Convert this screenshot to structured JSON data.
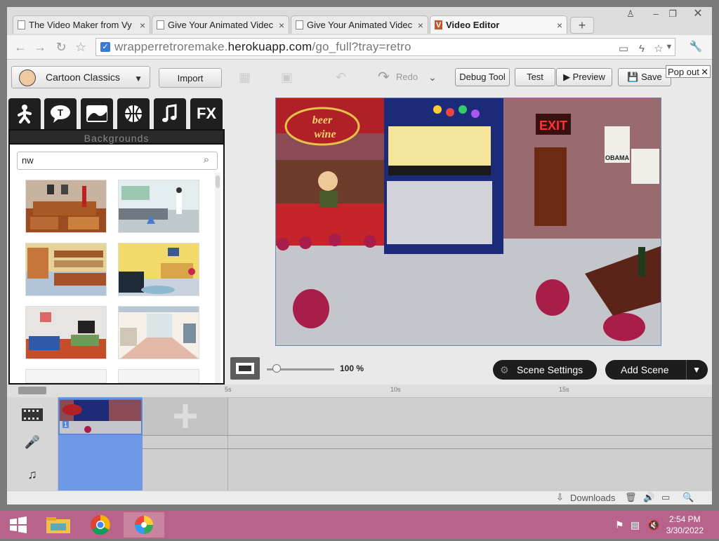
{
  "browser": {
    "tabs": [
      {
        "title": "The Video Maker from Vy",
        "active": false
      },
      {
        "title": "Give Your Animated Videc",
        "active": false
      },
      {
        "title": "Give Your Animated Videc",
        "active": false
      },
      {
        "title": "Video Editor",
        "active": true
      }
    ],
    "new_tab_symbol": "+",
    "url_prefix": "wrapperretroremake.",
    "url_domain": "herokuapp.com",
    "url_path": "/go_full?tray=retro"
  },
  "app": {
    "theme_label": "Cartoon Classics",
    "import_label": "Import",
    "category_tabs": [
      "character-icon",
      "speech-bubble-icon",
      "background-icon",
      "prop-ball-icon",
      "music-note-icon",
      "FX"
    ],
    "library_title": "Backgrounds",
    "search_value": "nw",
    "toolbar": {
      "redo_label": "Redo",
      "debug_label": "Debug Tool",
      "test_label": "Test",
      "preview_label": "Preview",
      "save_label": "Save",
      "popout_label": "Pop out"
    },
    "stage_signs": {
      "bar_sign_line1": "beer",
      "bar_sign_line2": "wine",
      "exit": "EXIT",
      "poster": "OBAMA"
    },
    "zoom_value": "100 %",
    "zoom_fraction": 0.15,
    "scene_settings_label": "Scene Settings",
    "add_scene_label": "Add Scene",
    "timeline": {
      "ruler_labels": [
        "5s",
        "10s",
        "15s"
      ],
      "scene_number": "1"
    }
  },
  "statusbar": {
    "downloads_label": "Downloads"
  },
  "taskbar": {
    "time": "2:54 PM",
    "date": "3/30/2022"
  },
  "colors": {
    "accent_blue": "#6e99e8",
    "taskbar": "#b7638a",
    "dark_button": "#1d1d1d"
  }
}
